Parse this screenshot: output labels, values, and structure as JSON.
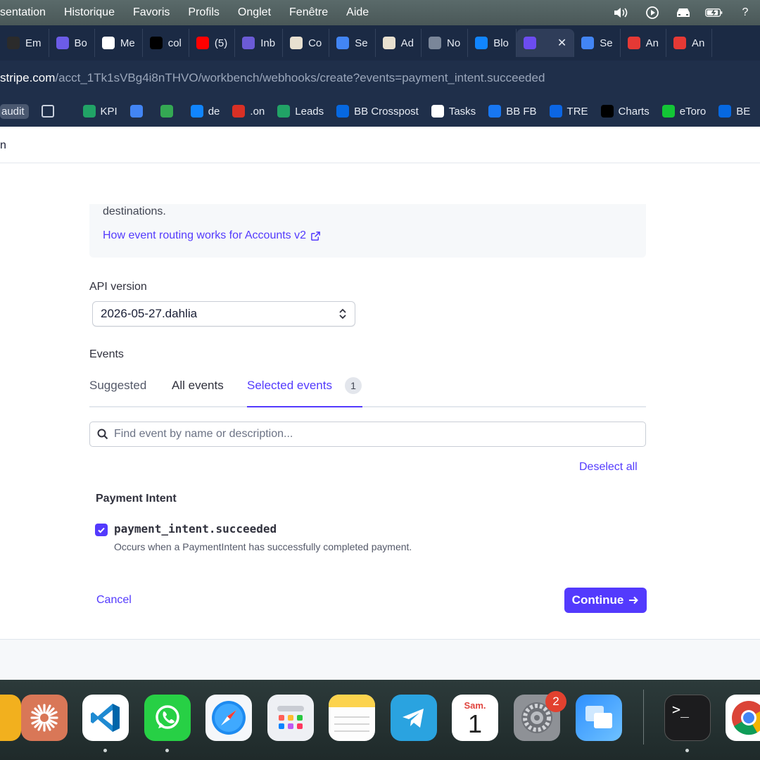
{
  "menubar": {
    "items": [
      "sentation",
      "Historique",
      "Favoris",
      "Profils",
      "Onglet",
      "Fenêtre",
      "Aide"
    ],
    "tray_icons": [
      "volume-icon",
      "play-circle-icon",
      "car-icon",
      "battery-icon"
    ],
    "tray_trailing": "?"
  },
  "tabs": [
    {
      "label": "Em",
      "icon": "email-icon",
      "color": "#2b2b2b"
    },
    {
      "label": "Bo",
      "icon": "bolt-icon",
      "color": "#6c5ce7"
    },
    {
      "label": "Me",
      "icon": "info-icon",
      "color": "#ffffff"
    },
    {
      "label": "col",
      "icon": "r-icon",
      "color": "#000000"
    },
    {
      "label": "(5)",
      "icon": "youtube-icon",
      "color": "#ff0000"
    },
    {
      "label": "Inb",
      "icon": "inbox-icon",
      "color": "#6b5bd6"
    },
    {
      "label": "Co",
      "icon": "coin-icon",
      "color": "#e8e0d0"
    },
    {
      "label": "Se",
      "icon": "docs-icon",
      "color": "#4285f4"
    },
    {
      "label": "Ad",
      "icon": "coin-icon",
      "color": "#e8e0d0"
    },
    {
      "label": "No",
      "icon": "globe-icon",
      "color": "#7a8699"
    },
    {
      "label": "Blo",
      "icon": "butterfly-icon",
      "color": "#1185fe"
    },
    {
      "label": "",
      "icon": "chat-icon",
      "color": "#6c4cf0",
      "active": true,
      "close": "✕"
    },
    {
      "label": "Se",
      "icon": "docs-icon",
      "color": "#4285f4"
    },
    {
      "label": "An",
      "icon": "x-icon",
      "color": "#e53935"
    },
    {
      "label": "An",
      "icon": "x-icon",
      "color": "#e53935"
    }
  ],
  "address": {
    "host": "stripe.com",
    "path": "/acct_1Tk1sVBg4i8nTHVO/workbench/webhooks/create?events=payment_intent.succeeded"
  },
  "bookmarks": [
    {
      "label": "audit",
      "icon": "",
      "pill": true
    },
    {
      "label": "",
      "icon": "grid-icon"
    },
    {
      "label": "KPI",
      "icon": "sheet-icon",
      "color": "#21a366"
    },
    {
      "label": "",
      "icon": "docs-icon",
      "color": "#4285f4"
    },
    {
      "label": "",
      "icon": "maps-pin-icon",
      "color": "#34a853"
    },
    {
      "label": "de",
      "icon": "butterfly-icon",
      "color": "#1185fe"
    },
    {
      "label": ".on",
      "icon": "pdf-icon",
      "color": "#d93025"
    },
    {
      "label": "Leads",
      "icon": "sheet-icon",
      "color": "#21a366"
    },
    {
      "label": "BB Crosspost",
      "icon": "meta-icon",
      "color": "#0668e1"
    },
    {
      "label": "Tasks",
      "icon": "laurel-icon",
      "color": "#ffffff"
    },
    {
      "label": "BB FB",
      "icon": "facebook-icon",
      "color": "#1877f2"
    },
    {
      "label": "TRE",
      "icon": "trello-icon",
      "color": "#0c66e4"
    },
    {
      "label": "Charts",
      "icon": "tradingview-icon",
      "color": "#000000"
    },
    {
      "label": "eToro",
      "icon": "etoro-icon",
      "color": "#13c636"
    },
    {
      "label": "BE",
      "icon": "meta-icon",
      "color": "#0668e1"
    }
  ],
  "page": {
    "header_text": "n",
    "info": {
      "text": "destinations.",
      "link": "How event routing works for Accounts v2"
    },
    "api_version": {
      "label": "API version",
      "value": "2026-05-27.dahlia"
    },
    "events": {
      "label": "Events",
      "tabs": [
        "Suggested",
        "All events",
        "Selected events"
      ],
      "selected_count": "1",
      "search_placeholder": "Find event by name or description...",
      "deselect_all": "Deselect all",
      "group_title": "Payment Intent",
      "event_name": "payment_intent.succeeded",
      "event_description": "Occurs when a PaymentIntent has successfully completed payment.",
      "event_checked": true
    },
    "footer": {
      "cancel": "Cancel",
      "continue": "Continue"
    },
    "colors": {
      "accent": "#533afd"
    }
  },
  "dock": {
    "apps": [
      "partial-app-icon",
      "claude-icon",
      "vscode-icon",
      "whatsapp-icon",
      "safari-icon",
      "launchpad-icon",
      "notes-icon",
      "telegram-icon",
      "calendar-icon",
      "system-settings-icon",
      "screen-sharing-icon",
      "terminal-icon",
      "chrome-icon"
    ],
    "calendar_day": "Sam.",
    "calendar_date": "1",
    "settings_badge": "2"
  }
}
